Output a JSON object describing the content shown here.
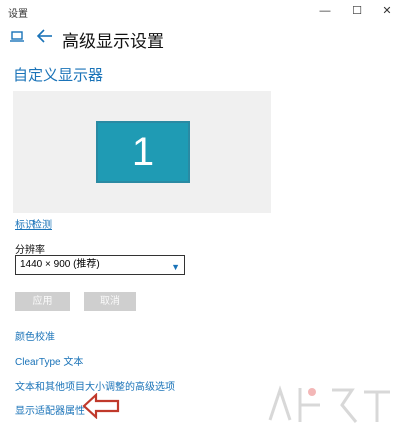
{
  "window": {
    "title": "设置",
    "minimize_glyph": "—",
    "maximize_glyph": "☐",
    "close_glyph": "✕"
  },
  "header": {
    "page_title": "高级显示设置",
    "home_icon": "home-icon",
    "back_icon": "back-arrow-icon"
  },
  "customize": {
    "section_title": "自定义显示器",
    "monitor_number": "1",
    "identify_link": "标识",
    "detect_link": "检测"
  },
  "resolution": {
    "label": "分辨率",
    "selected": "1440 × 900 (推荐)"
  },
  "buttons": {
    "apply": "应用",
    "cancel": "取消"
  },
  "links": {
    "color_calibration": "颜色校准",
    "cleartype": "ClearType 文本",
    "advanced_text": "文本和其他项目大小调整的高级选项",
    "adapter_properties": "显示适配器属性"
  },
  "colors": {
    "accent": "#1a73b8",
    "monitor_tile": "#1f9bb4",
    "arrow": "#c0392b"
  }
}
